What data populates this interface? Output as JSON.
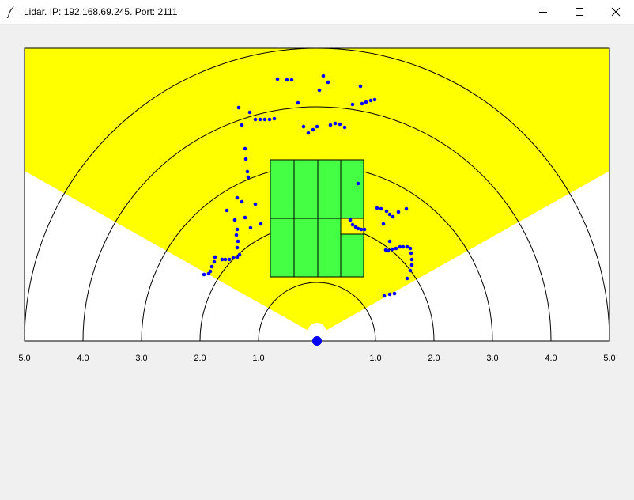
{
  "window": {
    "title": "Lidar. IP: 192.168.69.245. Port: 2111",
    "app_icon": "feather-icon",
    "controls": [
      "minimize-icon",
      "maximize-icon",
      "close-icon"
    ]
  },
  "plot": {
    "background_color": "#ffffff",
    "field_of_view_color": "#ffff00",
    "zone_color": "#44ff44",
    "point_color": "#0000ff",
    "sensor_color": "#0000ff",
    "axis_ticks_left": [
      "5.0",
      "4.0",
      "3.0",
      "2.0",
      "1.0"
    ],
    "axis_ticks_right": [
      "1.0",
      "2.0",
      "3.0",
      "4.0",
      "5.0"
    ],
    "range_arcs_m": [
      1,
      2,
      3,
      4,
      5
    ]
  }
}
